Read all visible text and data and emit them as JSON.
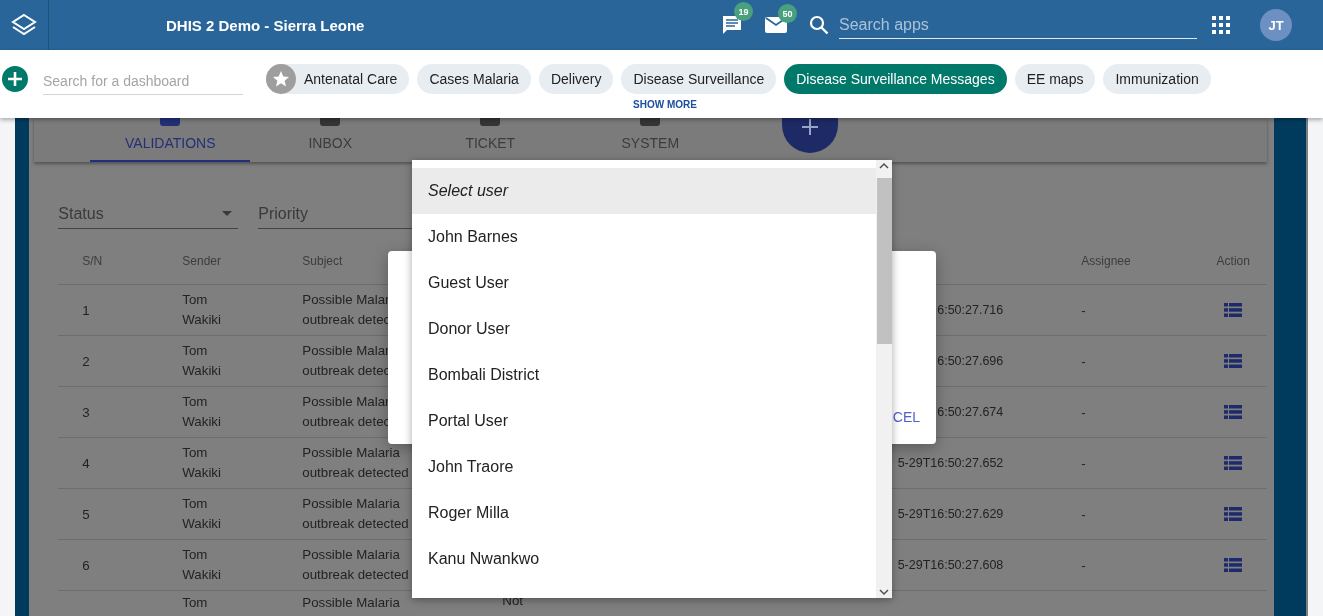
{
  "header": {
    "title": "DHIS 2 Demo - Sierra Leone",
    "messages_badge": "19",
    "mail_badge": "50",
    "search": {
      "placeholder": "Search apps"
    },
    "avatar": "JT"
  },
  "dashboards": {
    "search": {
      "placeholder": "Search for a dashboard"
    },
    "items": [
      {
        "label": "Antenatal Care",
        "starred": true,
        "selected": false
      },
      {
        "label": "Cases Malaria",
        "starred": false,
        "selected": false
      },
      {
        "label": "Delivery",
        "starred": false,
        "selected": false
      },
      {
        "label": "Disease Surveillance",
        "starred": false,
        "selected": false
      },
      {
        "label": "Disease Surveillance Messages",
        "starred": false,
        "selected": true
      },
      {
        "label": "EE maps",
        "starred": false,
        "selected": false
      },
      {
        "label": "Immunization",
        "starred": false,
        "selected": false
      }
    ],
    "show_more": "SHOW MORE"
  },
  "tabs": [
    {
      "label": "VALIDATIONS",
      "selected": true
    },
    {
      "label": "INBOX",
      "selected": false
    },
    {
      "label": "TICKET",
      "selected": false
    },
    {
      "label": "SYSTEM",
      "selected": false
    }
  ],
  "filters": [
    {
      "label": "Status"
    },
    {
      "label": "Priority"
    }
  ],
  "table": {
    "columns": {
      "sn": "S/N",
      "sender": "Sender",
      "subject": "Subject",
      "assignee": "Assignee",
      "action": "Action"
    },
    "rows": [
      {
        "sn": "1",
        "sender": "Tom\nWakiki",
        "subject": "Possible Malar\noutbreak detec",
        "date": "6:50:27.716",
        "assignee": "-"
      },
      {
        "sn": "2",
        "sender": "Tom\nWakiki",
        "subject": "Possible Malar\noutbreak detec",
        "date": "6:50:27.696",
        "assignee": "-"
      },
      {
        "sn": "3",
        "sender": "Tom\nWakiki",
        "subject": "Possible Malar\noutbreak detec",
        "date": "6:50:27.674",
        "assignee": "-"
      },
      {
        "sn": "4",
        "sender": "Tom\nWakiki",
        "subject": "Possible Malaria\noutbreak detected",
        "date": "5-29T16:50:27.652",
        "assignee": "-"
      },
      {
        "sn": "5",
        "sender": "Tom\nWakiki",
        "subject": "Possible Malaria\noutbreak detected",
        "date": "5-29T16:50:27.629",
        "assignee": "-"
      },
      {
        "sn": "6",
        "sender": "Tom\nWakiki",
        "subject": "Possible Malaria\noutbreak detected",
        "date": "5-29T16:50:27.608",
        "assignee": "-"
      },
      {
        "sender": "Tom",
        "subject": "Possible Malaria",
        "status": "Not"
      }
    ]
  },
  "dialog": {
    "cancel": "CEL"
  },
  "user_dropdown": [
    {
      "label": "Select user",
      "kind": "placeholder",
      "selected": true
    },
    {
      "label": "John Barnes",
      "kind": "user",
      "selected": false
    },
    {
      "label": "Guest User",
      "kind": "user",
      "selected": false
    },
    {
      "label": "Donor User",
      "kind": "user",
      "selected": false
    },
    {
      "label": "Bombali District",
      "kind": "user",
      "selected": false
    },
    {
      "label": "Portal User",
      "kind": "user",
      "selected": false
    },
    {
      "label": "John Traore",
      "kind": "user",
      "selected": false
    },
    {
      "label": "Roger Milla",
      "kind": "user",
      "selected": false
    },
    {
      "label": "Kanu Nwankwo",
      "kind": "user",
      "selected": false
    }
  ]
}
